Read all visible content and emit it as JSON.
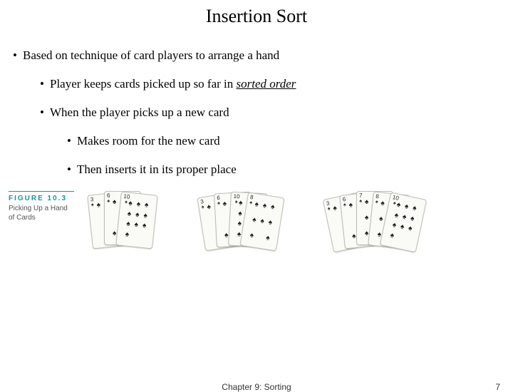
{
  "title": "Insertion Sort",
  "bullets": {
    "b1": "Based on technique of card players to arrange a hand",
    "b2a": "Player keeps cards picked up so far in ",
    "b2b": "sorted order",
    "b3": "When the player picks up a new card",
    "b4": "Makes room for the new card",
    "b5": "Then inserts it in its proper place"
  },
  "figure": {
    "number": "FIGURE 10.3",
    "caption": "Picking Up a Hand of Cards"
  },
  "hands": [
    {
      "cards": [
        "3",
        "6",
        "10"
      ]
    },
    {
      "cards": [
        "3",
        "6",
        "10",
        "8"
      ]
    },
    {
      "cards": [
        "3",
        "6",
        "7",
        "8",
        "10"
      ]
    }
  ],
  "footer": {
    "chapter": "Chapter 9: Sorting",
    "page": "7"
  }
}
